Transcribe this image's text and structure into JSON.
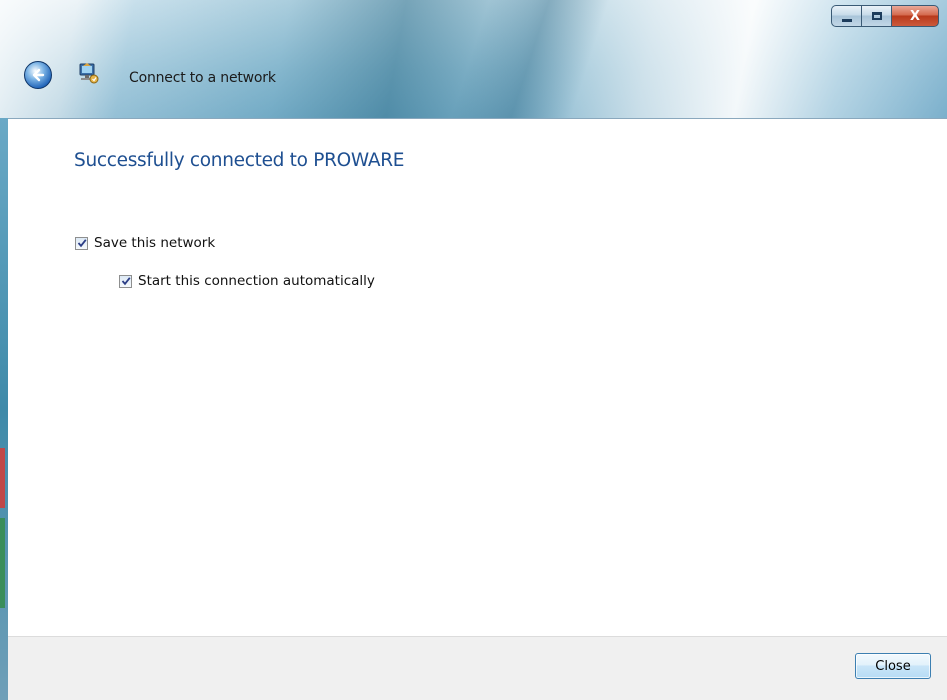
{
  "window": {
    "title": "Connect to a network",
    "caption_buttons": {
      "minimize_icon": "minimize-icon",
      "maximize_icon": "maximize-icon",
      "close_glyph": "X"
    }
  },
  "nav": {
    "back_icon": "back-arrow-icon",
    "app_icon": "network-connection-icon"
  },
  "main": {
    "heading": "Successfully connected to PROWARE",
    "options": [
      {
        "label": "Save this network",
        "checked": true
      },
      {
        "label": "Start this connection automatically",
        "checked": true
      }
    ]
  },
  "footer": {
    "close_label": "Close"
  },
  "colors": {
    "heading": "#1e4f91",
    "close_button_border": "#3c7fb1"
  }
}
